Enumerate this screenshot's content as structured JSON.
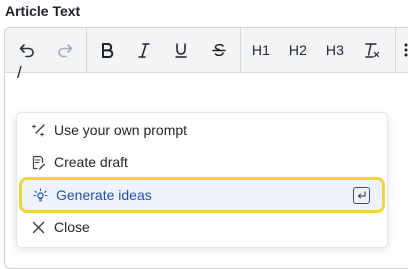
{
  "field": {
    "label": "Article Text"
  },
  "toolbar": {
    "undo_icon": "undo-icon",
    "redo_icon": "redo-icon",
    "bold_icon": "bold-icon",
    "italic_icon": "italic-icon",
    "underline_icon": "underline-icon",
    "strikethrough_icon": "strikethrough-icon",
    "h1_label": "H1",
    "h2_label": "H2",
    "h3_label": "H3",
    "clear_format_icon": "clear-formatting-icon"
  },
  "editor": {
    "content": "/"
  },
  "menu": {
    "items": [
      {
        "label": "Use your own prompt",
        "icon": "magic-wand-icon"
      },
      {
        "label": "Create draft",
        "icon": "draft-document-icon"
      },
      {
        "label": "Generate ideas",
        "icon": "lightbulb-icon",
        "selected": true,
        "shortcut_icon": "enter-key-icon"
      },
      {
        "label": "Close",
        "icon": "close-icon"
      }
    ]
  },
  "colors": {
    "selected_bg": "#eef3fb",
    "selected_text": "#2250a8",
    "highlight_border": "#f2d33b",
    "toolbar_bg": "#f3f4f6"
  }
}
